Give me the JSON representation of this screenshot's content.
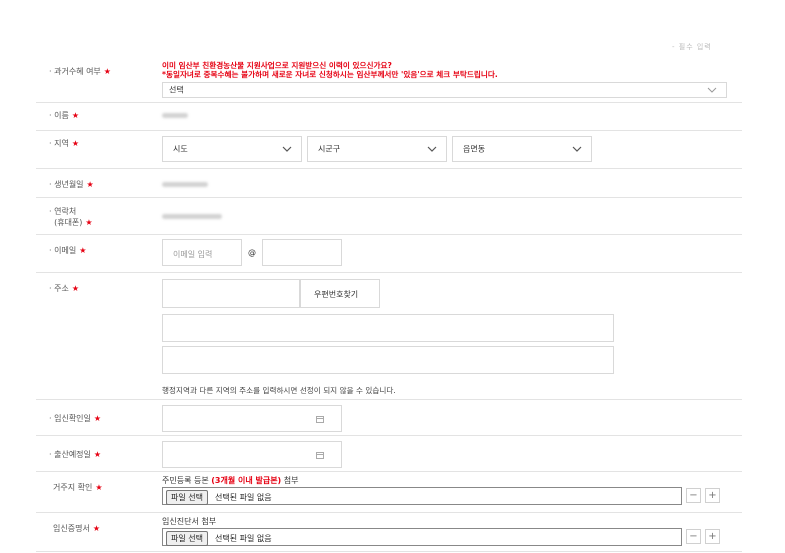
{
  "top_note": "- 필수 입력",
  "pregnancy_history": {
    "label": "과거수혜 여부",
    "warning_line1": "이미 임산부 친환경농산물 지원사업으로 지원받으신 이력이 있으신가요?",
    "warning_line2": "*동일자녀로 중복수혜는 불가하며 새로운 자녀로 신청하시는 임산부께서만 '있음'으로 체크 부탁드립니다.",
    "select_value": "선택"
  },
  "name": {
    "label": "이름"
  },
  "region": {
    "label": "지역",
    "sido": "시도",
    "sigungu": "시군구",
    "eupmyeondong": "읍면동"
  },
  "birth": {
    "label": "생년월일"
  },
  "phone": {
    "label_line1": "연락처",
    "label_line2": "(휴대폰)"
  },
  "email": {
    "label": "이메일",
    "placeholder": "이메일 입력",
    "at": "@"
  },
  "address": {
    "label": "주소",
    "postcode_button": "우편번호찾기",
    "notice": "행정지역과 다른 지역의 주소를 입력하시면 선정이 되지 않을 수 있습니다."
  },
  "pregnancy_confirm": {
    "label": "임신확인일"
  },
  "due_date": {
    "label": "출산예정일"
  },
  "residence": {
    "label": "거주지 확인",
    "desc_prefix": "주민등록 등본 ",
    "desc_bold": "(3개월 이내 발급본)",
    "desc_suffix": " 첨부",
    "file_button": "파일 선택",
    "file_status": "선택된 파일 없음"
  },
  "pregnancy_cert": {
    "label": "임신증명서",
    "desc": "임신진단서 첨부",
    "file_button": "파일 선택",
    "file_status": "선택된 파일 없음"
  },
  "required_mark": "★",
  "minus": "−",
  "plus": "+"
}
